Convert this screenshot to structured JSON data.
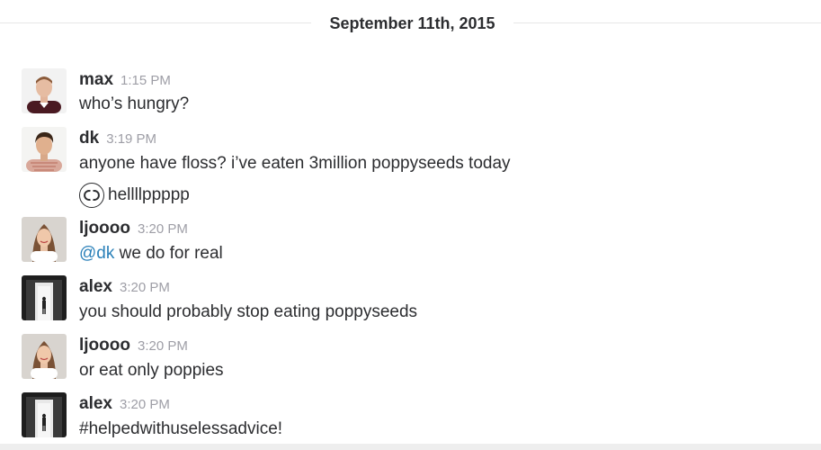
{
  "date_divider": {
    "label": "September 11th, 2015"
  },
  "messages": [
    {
      "username": "max",
      "time": "1:15 PM",
      "text": "who’s hungry?",
      "avatar": "max-avatar"
    },
    {
      "username": "dk",
      "time": "3:19 PM",
      "text": "anyone have floss? i’ve eaten 3million poppyseeds today",
      "avatar": "dk-avatar",
      "reaction": {
        "icon": "chanel-logo-icon",
        "text": "hellllppppp"
      }
    },
    {
      "username": "ljoooo",
      "time": "3:20 PM",
      "mention": "@dk",
      "text": " we do for real",
      "avatar": "ljoooo-avatar"
    },
    {
      "username": "alex",
      "time": "3:20 PM",
      "text": "you should probably stop eating poppyseeds",
      "avatar": "alex-avatar"
    },
    {
      "username": "ljoooo",
      "time": "3:20 PM",
      "text": "or eat only poppies",
      "avatar": "ljoooo-avatar"
    },
    {
      "username": "alex",
      "time": "3:20 PM",
      "text": "#helpedwithuselessadvice!",
      "avatar": "alex-avatar"
    }
  ],
  "colors": {
    "text": "#2c2d30",
    "timestamp": "#9e9ea6",
    "mention": "#2a80b9",
    "divider": "#e6e6e6"
  }
}
